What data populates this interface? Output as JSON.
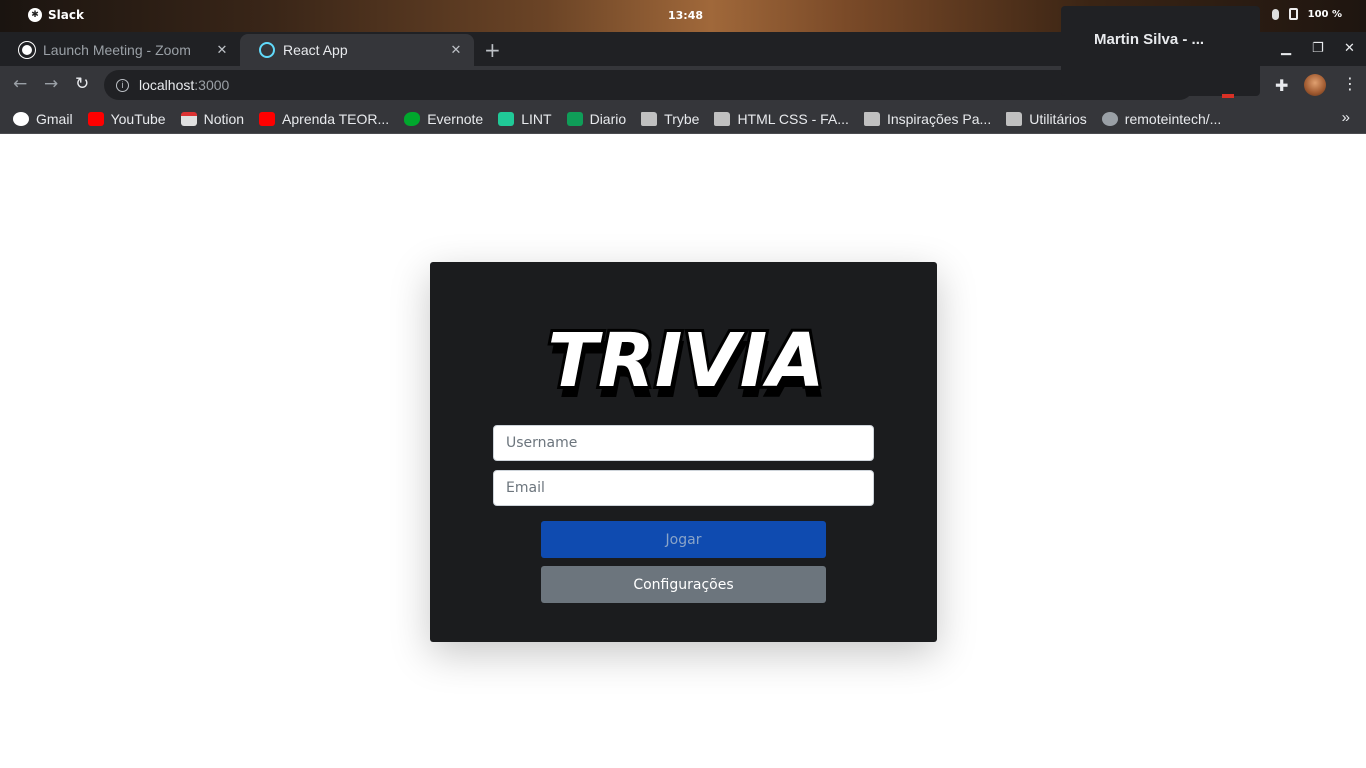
{
  "os": {
    "app_name": "Slack",
    "time": "13:48",
    "battery": "100 %"
  },
  "browser": {
    "tabs": [
      {
        "label": "Launch Meeting - Zoom",
        "active": false
      },
      {
        "label": "React App",
        "active": true
      }
    ],
    "url_host": "localhost",
    "url_port": ":3000",
    "bookmarks": [
      {
        "label": "Gmail",
        "icon": "google-icon"
      },
      {
        "label": "YouTube",
        "icon": "youtube-icon"
      },
      {
        "label": "Notion",
        "icon": "notion-icon"
      },
      {
        "label": "Aprenda TEOR...",
        "icon": "youtube-icon"
      },
      {
        "label": "Evernote",
        "icon": "evernote-icon"
      },
      {
        "label": "LINT",
        "icon": "lint-icon"
      },
      {
        "label": "Diario",
        "icon": "sheets-icon"
      },
      {
        "label": "Trybe",
        "icon": "folder-icon"
      },
      {
        "label": "HTML CSS - FA...",
        "icon": "folder-icon"
      },
      {
        "label": "Inspirações Pa...",
        "icon": "folder-icon"
      },
      {
        "label": "Utilitários",
        "icon": "folder-icon"
      },
      {
        "label": "remoteintech/...",
        "icon": "github-icon"
      }
    ]
  },
  "notification": {
    "text": "Martin Silva - ..."
  },
  "app": {
    "logo_text": "TRIVIA",
    "username_placeholder": "Username",
    "email_placeholder": "Email",
    "play_label": "Jogar",
    "settings_label": "Configurações"
  },
  "colors": {
    "card_bg": "#1b1c1e",
    "play_button": "#0f4bb0",
    "settings_button": "#6c757d"
  }
}
